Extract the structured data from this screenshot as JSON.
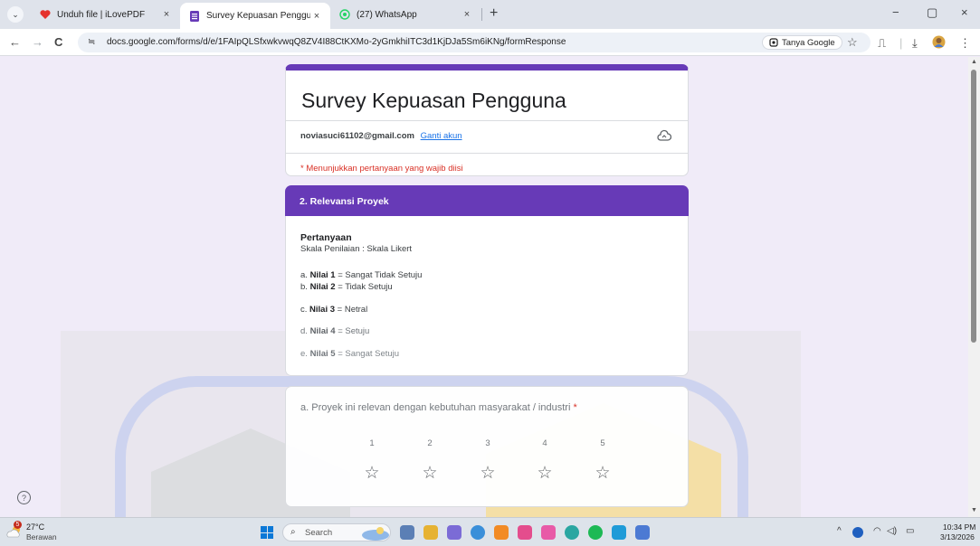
{
  "browser": {
    "tabs": [
      {
        "title": "Unduh file | iLovePDF",
        "close": "×"
      },
      {
        "title": "Survey Kepuasan Pengguna",
        "close": "×"
      },
      {
        "title": "(27) WhatsApp",
        "close": "×"
      }
    ],
    "new_tab": "+",
    "url": "docs.google.com/forms/d/e/1FAIpQLSfxwkvwqQ8ZV4I88CtKXMo-2yGmkhiITC3d1KjDJa5Sm6iKNg/formResponse",
    "tanya_google": "Tanya Google",
    "icons": {
      "back": "←",
      "forward": "→",
      "reload": "C",
      "site_info": "≒",
      "bookmark": "☆",
      "extensions": "⎍",
      "download": "⤓",
      "menu": "⋮",
      "minimize": "−",
      "restore": "▢",
      "close": "×",
      "tab_menu": "⌄"
    }
  },
  "form": {
    "title": "Survey Kepuasan Pengguna",
    "email": "noviasuci61102@gmail.com",
    "switch_account": "Ganti akun",
    "required_note": "* Menunjukkan pertanyaan yang wajib diisi",
    "section_title": "2. Relevansi Proyek",
    "description": {
      "heading": "Pertanyaan",
      "scale_label": "Skala Penilaian : Skala Likert",
      "items": [
        {
          "prefix": "a. ",
          "key": "Nilai 1",
          "text": " = Sangat Tidak Setuju"
        },
        {
          "prefix": "b. ",
          "key": "Nilai 2",
          "text": " = Tidak Setuju"
        },
        {
          "prefix": "c. ",
          "key": "Nilai 3",
          "text": " = Netral"
        },
        {
          "prefix": "d. ",
          "key": "Nilai 4",
          "text": " = Setuju"
        },
        {
          "prefix": "e. ",
          "key": "Nilai  5",
          "text": " = Sangat Setuju"
        }
      ]
    },
    "question": {
      "text": "a. Proyek ini relevan dengan kebutuhan masyarakat / industri",
      "required_mark": "*",
      "scale": [
        "1",
        "2",
        "3",
        "4",
        "5"
      ],
      "star_glyph": "☆"
    },
    "help": "?"
  },
  "taskbar": {
    "temperature": "27°C",
    "condition": "Berawan",
    "weather_badge": "5",
    "search_placeholder": "Search",
    "time": "10:34 PM",
    "date": "3/13/2026",
    "tray": {
      "chevron": "^",
      "wifi": "◠",
      "volume": "◁)",
      "battery": "▭"
    }
  },
  "colors": {
    "accent": "#673ab7",
    "required": "#d93025",
    "link": "#1a73e8",
    "page_bg": "#f0ebf8"
  }
}
